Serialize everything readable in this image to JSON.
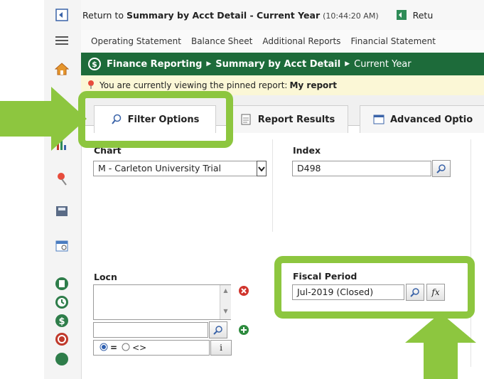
{
  "topbar": {
    "return_prefix": "Return to ",
    "return_target": "Summary by Acct Detail - Current Year",
    "return_time": "(10:44:20 AM)",
    "right_label": "Retu"
  },
  "menu": {
    "items": [
      "Operating Statement",
      "Balance Sheet",
      "Additional Reports",
      "Financial Statement"
    ]
  },
  "breadcrumb": {
    "items": [
      "Finance Reporting",
      "Summary by Acct Detail",
      "Current Year"
    ]
  },
  "pinned": {
    "text": "You are currently viewing the pinned report: ",
    "report_name": "My report"
  },
  "tabs": [
    {
      "label": "Filter Options",
      "active": true
    },
    {
      "label": "Report Results",
      "active": false
    },
    {
      "label": "Advanced Optio",
      "active": false
    }
  ],
  "filters": {
    "chart": {
      "label": "Chart",
      "value": "M - Carleton University Trial"
    },
    "index": {
      "label": "Index",
      "value": "D498"
    },
    "locn": {
      "label": "Locn",
      "operator_symbol": "=",
      "operator_alt": "<>",
      "info_glyph": "i"
    },
    "fiscal_period": {
      "label": "Fiscal Period",
      "value": "Jul-2019 (Closed)",
      "fx_label": "fx"
    }
  },
  "colors": {
    "accent_green": "#8dc63f",
    "header_green": "#1d6b3a",
    "pinned_bg": "#fbf7d6"
  },
  "icons": {
    "rail": [
      "home-icon",
      "chart-icon",
      "pin-icon",
      "save-icon",
      "calendar-icon",
      "book-icon",
      "clock-icon",
      "dollar-icon",
      "refresh-icon"
    ],
    "search": "magnifier-icon"
  }
}
